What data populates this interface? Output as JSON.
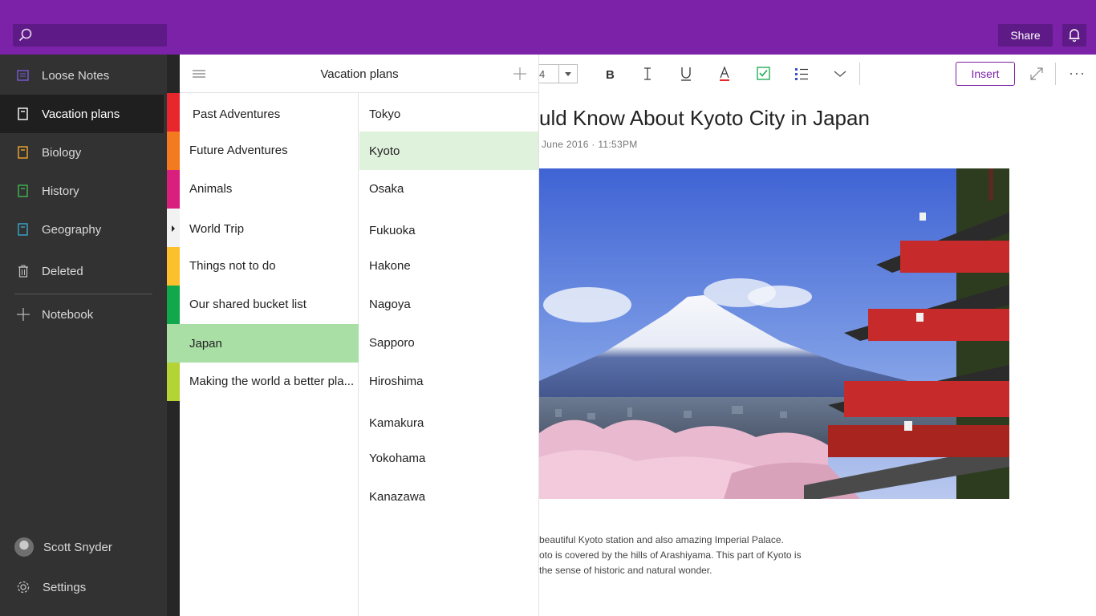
{
  "topbar": {
    "search_placeholder": "",
    "share_label": "Share",
    "accent": "#7b22a8"
  },
  "sidebar": {
    "items": [
      {
        "label": "Loose Notes",
        "icon": "loose-notes-icon",
        "color": "#7a5ad6"
      },
      {
        "label": "Vacation plans",
        "icon": "notebook-icon",
        "color": "#ffffff",
        "active": true
      },
      {
        "label": "Biology",
        "icon": "notebook-icon",
        "color": "#f2a72e"
      },
      {
        "label": "History",
        "icon": "notebook-icon",
        "color": "#3fb950"
      },
      {
        "label": "Geography",
        "icon": "notebook-icon",
        "color": "#3aa8c9"
      },
      {
        "label": "Deleted",
        "icon": "trash-icon",
        "color": "#bdbdbd"
      }
    ],
    "add_notebook_label": "Notebook",
    "user_name": "Scott Snyder",
    "settings_label": "Settings"
  },
  "panel": {
    "title": "Vacation plans"
  },
  "sections": [
    {
      "label": "Past Adventures",
      "color": "#e8262b"
    },
    {
      "label": "Future Adventures",
      "color": "#f47a1f"
    },
    {
      "label": "Animals",
      "color": "#d81f7d"
    },
    {
      "label": "World Trip",
      "color": "#f2f2f2"
    },
    {
      "label": "Things not to do",
      "color": "#fcc02d"
    },
    {
      "label": "Our shared bucket list",
      "color": "#10a84a"
    },
    {
      "label": "Japan",
      "color": "#a9dea5",
      "active": true
    },
    {
      "label": "Making the world a better pla...",
      "color": "#b4d334"
    }
  ],
  "pages": [
    {
      "label": "Tokyo"
    },
    {
      "label": "Kyoto",
      "active": true
    },
    {
      "label": "Osaka"
    },
    {
      "label": "Fukuoka"
    },
    {
      "label": "Hakone"
    },
    {
      "label": "Nagoya"
    },
    {
      "label": "Sapporo"
    },
    {
      "label": "Hiroshima"
    },
    {
      "label": "Kamakura"
    },
    {
      "label": "Yokohama"
    },
    {
      "label": "Kanazawa"
    }
  ],
  "toolbar": {
    "font_size": "4",
    "insert_label": "Insert"
  },
  "note": {
    "title": "uld Know About Kyoto City in Japan",
    "date": "June 2016  ·  11:53PM",
    "lines": [
      "beautiful Kyoto station and also amazing Imperial Palace.",
      "oto is covered by the hills of Arashiyama. This part of Kyoto is",
      "the sense of historic and natural wonder."
    ]
  }
}
